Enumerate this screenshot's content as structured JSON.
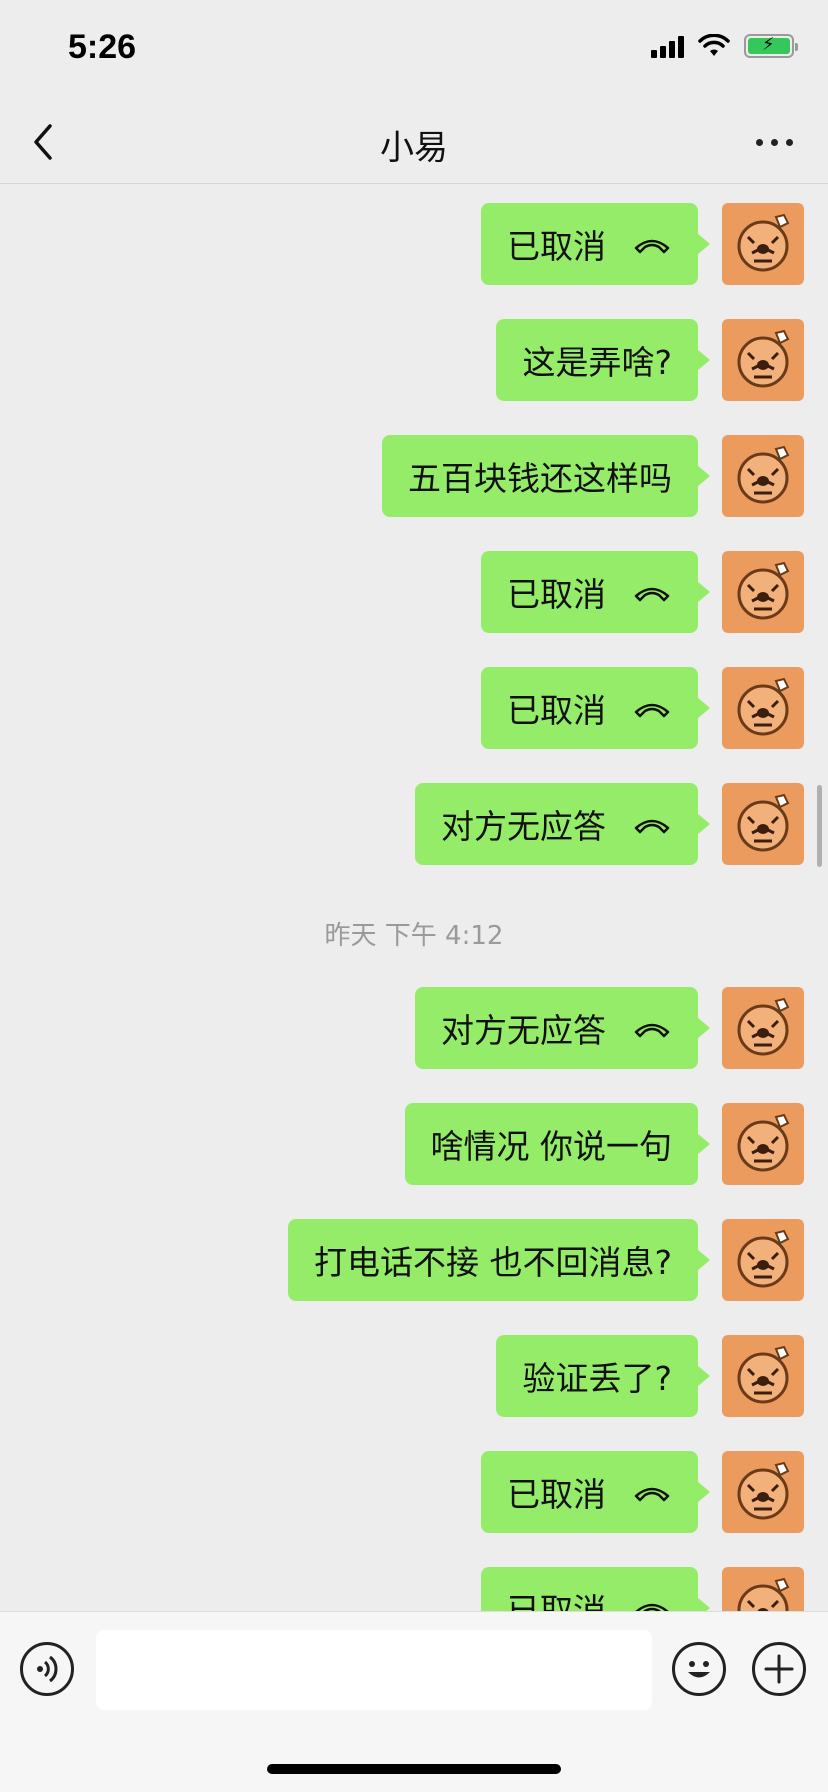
{
  "status_bar": {
    "time": "5:26",
    "battery_color": "#34c759"
  },
  "nav": {
    "title": "小易",
    "back_icon": "chevron-left-icon",
    "more_icon": "more-dots-icon"
  },
  "messages": [
    {
      "text": "已取消",
      "kind": "call",
      "icon": "hangup-icon"
    },
    {
      "text": "这是弄啥?",
      "kind": "text"
    },
    {
      "text": "五百块钱还这样吗",
      "kind": "text"
    },
    {
      "text": "已取消",
      "kind": "call",
      "icon": "hangup-icon"
    },
    {
      "text": "已取消",
      "kind": "call",
      "icon": "hangup-icon"
    },
    {
      "text": "对方无应答",
      "kind": "call",
      "icon": "hangup-icon"
    },
    {
      "text": "对方无应答",
      "kind": "call",
      "icon": "hangup-icon"
    },
    {
      "text": "啥情况 你说一句",
      "kind": "text"
    },
    {
      "text": "打电话不接 也不回消息?",
      "kind": "text"
    },
    {
      "text": "验证丢了?",
      "kind": "text"
    },
    {
      "text": "已取消",
      "kind": "call",
      "icon": "hangup-icon"
    },
    {
      "text": "已取消",
      "kind": "call",
      "icon": "hangup-icon"
    }
  ],
  "timestamp": "昨天 下午 4:12",
  "input_bar": {
    "placeholder": "",
    "voice_icon": "voice-icon",
    "emoji_icon": "emoji-icon",
    "plus_icon": "plus-icon"
  },
  "colors": {
    "bubble": "#95ec69",
    "background": "#ededed",
    "avatar": "#ea9b5d"
  }
}
